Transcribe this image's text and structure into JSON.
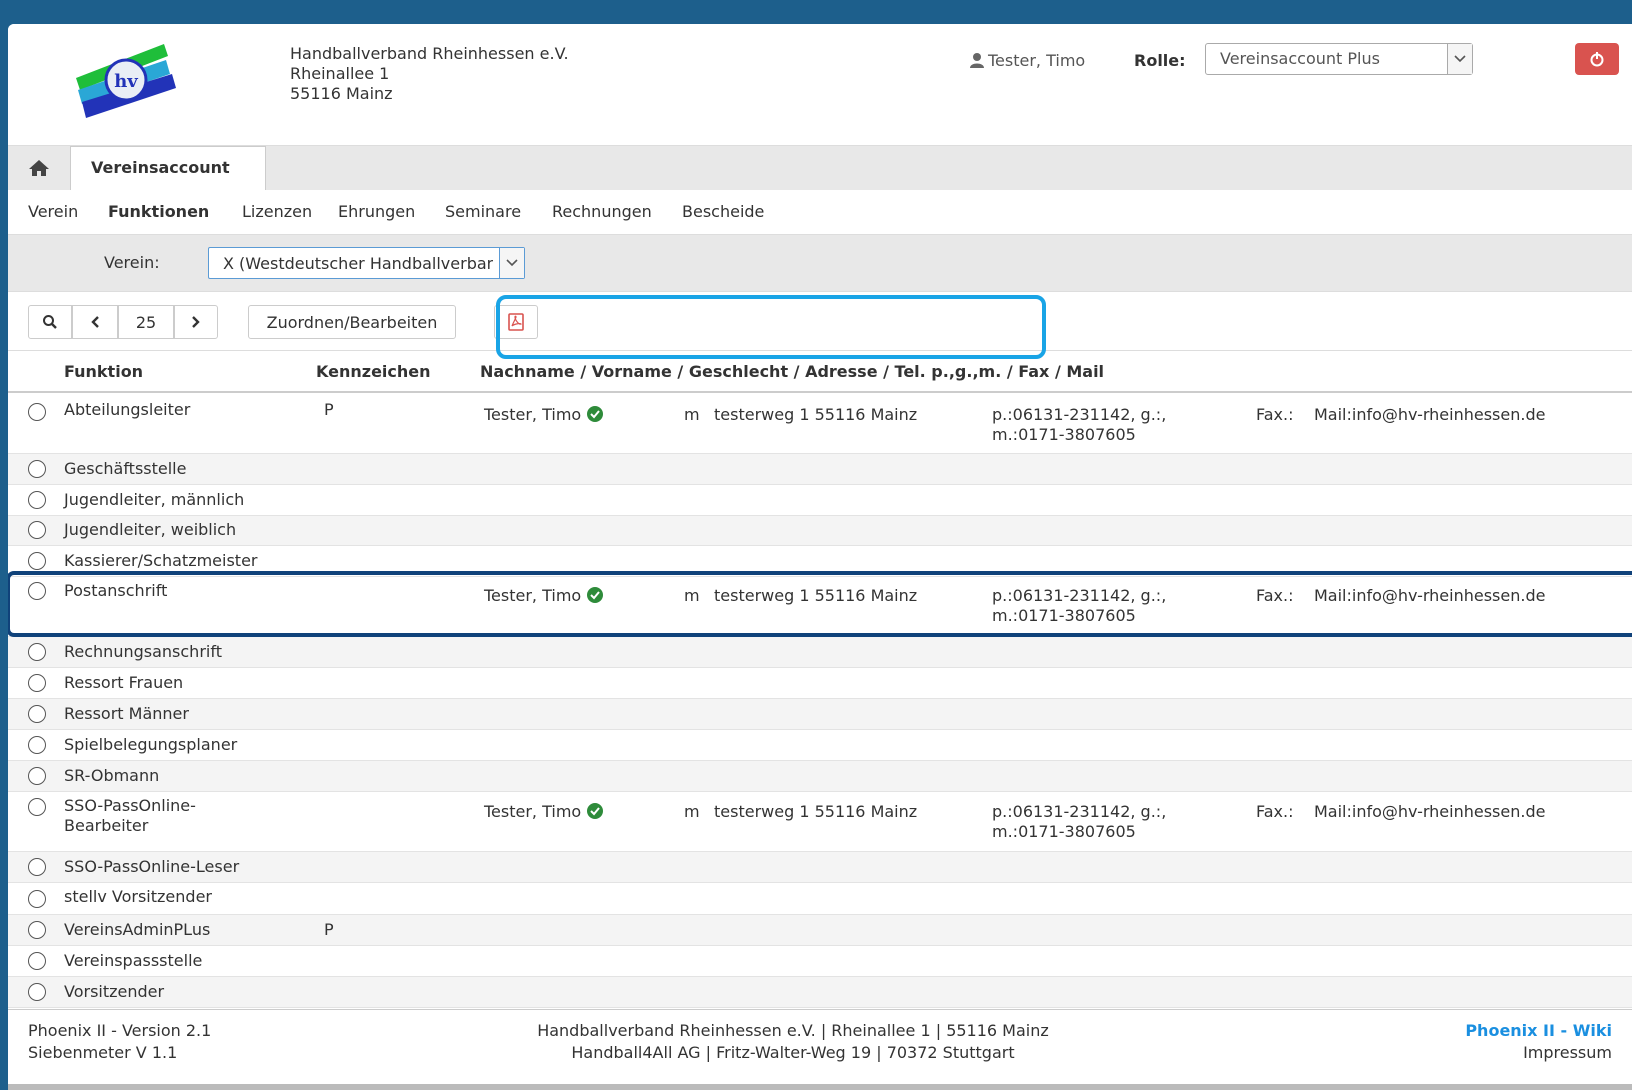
{
  "header": {
    "org_lines": [
      "Handballverband Rheinhessen e.V.",
      "Rheinallee 1",
      "55116 Mainz"
    ],
    "user_name": "Tester, Timo",
    "role_label": "Rolle:",
    "role_value": "Vereinsaccount Plus"
  },
  "tabs": {
    "active": "Vereinsaccount"
  },
  "subnav": [
    "Verein",
    "Funktionen",
    "Lizenzen",
    "Ehrungen",
    "Seminare",
    "Rechnungen",
    "Bescheide"
  ],
  "subnav_active": "Funktionen",
  "filter": {
    "label": "Verein:",
    "value": "X (Westdeutscher Handballverband)"
  },
  "toolbar": {
    "page_size": "25",
    "assign_label": "Zuordnen/Bearbeiten"
  },
  "table": {
    "headers": {
      "funktion": "Funktion",
      "kennzeichen": "Kennzeichen",
      "details": "Nachname / Vorname / Geschlecht / Adresse / Tel. p.,g.,m. / Fax / Mail"
    },
    "rows": [
      {
        "funktion": "Abteilungsleiter",
        "kennzeichen": "P",
        "name": "Tester, Timo",
        "geschlecht": "m",
        "adresse": "testerweg 1 55116 Mainz",
        "tel1": "p.:06131-231142, g.:,",
        "tel2": "m.:0171-3807605",
        "fax": "Fax.:",
        "mail": "Mail:info@hv-rheinhessen.de"
      },
      {
        "funktion": "Geschäftsstelle"
      },
      {
        "funktion": "Jugendleiter, männlich"
      },
      {
        "funktion": "Jugendleiter, weiblich"
      },
      {
        "funktion": "Kassierer/Schatzmeister"
      },
      {
        "funktion": "Postanschrift",
        "name": "Tester, Timo",
        "geschlecht": "m",
        "adresse": "testerweg 1 55116 Mainz",
        "tel1": "p.:06131-231142, g.:,",
        "tel2": "m.:0171-3807605",
        "fax": "Fax.:",
        "mail": "Mail:info@hv-rheinhessen.de"
      },
      {
        "funktion": "Rechnungsanschrift"
      },
      {
        "funktion": "Ressort Frauen"
      },
      {
        "funktion": "Ressort Männer"
      },
      {
        "funktion": "Spielbelegungsplaner"
      },
      {
        "funktion": "SR-Obmann"
      },
      {
        "funktion": "SSO-PassOnline-Bearbeiter",
        "funktion_lines": [
          "SSO-PassOnline-",
          "Bearbeiter"
        ],
        "name": "Tester, Timo",
        "geschlecht": "m",
        "adresse": "testerweg 1 55116 Mainz",
        "tel1": "p.:06131-231142, g.:,",
        "tel2": "m.:0171-3807605",
        "fax": "Fax.:",
        "mail": "Mail:info@hv-rheinhessen.de"
      },
      {
        "funktion": "SSO-PassOnline-Leser"
      },
      {
        "funktion": "stellv Vorsitzender"
      },
      {
        "funktion": "VereinsAdminPLus",
        "kennzeichen": "P"
      },
      {
        "funktion": "Vereinspassstelle"
      },
      {
        "funktion": "Vorsitzender"
      }
    ]
  },
  "footer": {
    "version": "Phoenix II - Version 2.1",
    "siebenmeter": "Siebenmeter V 1.1",
    "line1": "Handballverband Rheinhessen e.V. | Rheinallee 1 | 55116 Mainz",
    "line2": "Handball4All AG | Fritz-Walter-Weg 19 | 70372 Stuttgart",
    "wiki": "Phoenix II - Wiki",
    "impressum": "Impressum"
  },
  "colors": {
    "accent_blue": "#19a4e6",
    "highlight_navy": "#10427a",
    "danger": "#d9534f",
    "ok_green": "#2e8b3a",
    "link": "#1a8fe0"
  },
  "icons": [
    "logo",
    "user-icon",
    "power-icon",
    "home-icon",
    "search-icon",
    "chevron-left-icon",
    "chevron-right-icon",
    "pdf-icon",
    "check-circle-icon",
    "chevron-down-icon"
  ]
}
